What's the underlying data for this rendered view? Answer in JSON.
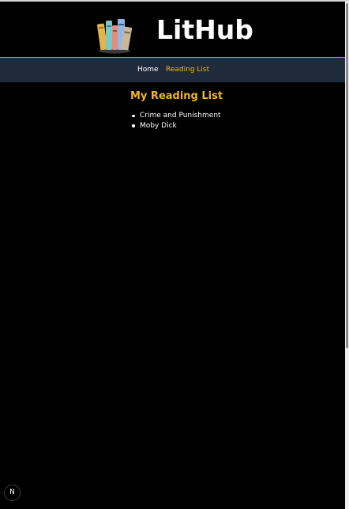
{
  "header": {
    "logo_icon": "books-icon",
    "title": "LitHub"
  },
  "nav": {
    "items": [
      {
        "label": "Home",
        "active": false
      },
      {
        "label": "Reading List",
        "active": true
      }
    ]
  },
  "main": {
    "heading": "My Reading List",
    "books": [
      "Crime and Punishment",
      "Moby Dick"
    ]
  },
  "dev_badge": {
    "icon": "nextjs-icon",
    "label": "N"
  },
  "colors": {
    "accent": "#f2b623",
    "nav_background": "#1f2a3b",
    "page_background": "#000000",
    "header_border": "#c99a1c"
  }
}
